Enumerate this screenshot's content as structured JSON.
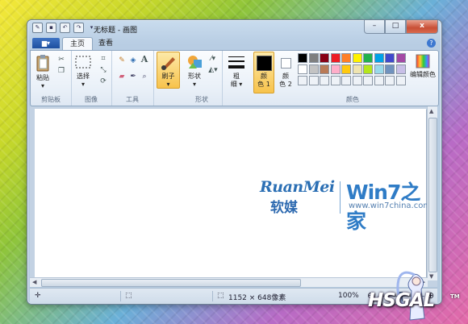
{
  "window": {
    "title": "无标题 - 画图",
    "controls": {
      "minimize": "–",
      "maximize": "□",
      "close": "x"
    }
  },
  "tabs": {
    "file_menu": "▆▾",
    "home": "主页",
    "view": "查看",
    "help": "?"
  },
  "ribbon": {
    "clipboard": {
      "paste": "粘贴",
      "group": "剪贴板"
    },
    "image": {
      "select": "选择",
      "group": "图像"
    },
    "tools": {
      "group": "工具",
      "text_glyph": "A"
    },
    "brush": {
      "label": "刷子"
    },
    "shapes": {
      "label": "形状",
      "group": "形状"
    },
    "size": {
      "line1": "粗",
      "line2": "细"
    },
    "color1": {
      "line1": "颜",
      "line2": "色 1"
    },
    "color2": {
      "line1": "颜",
      "line2": "色 2"
    },
    "colors": {
      "group": "颜色",
      "edit": "编辑颜色"
    }
  },
  "palette": {
    "row1": [
      "#000000",
      "#7f7f7f",
      "#880015",
      "#ed1c24",
      "#ff7f27",
      "#fff200",
      "#22b14c",
      "#00a2e8",
      "#3f48cc",
      "#a349a4"
    ],
    "row2": [
      "#ffffff",
      "#c3c3c3",
      "#b97a57",
      "#ffaec9",
      "#ffc90e",
      "#efe4b0",
      "#b5e61d",
      "#99d9ea",
      "#7092be",
      "#c8bfe7"
    ],
    "row3": [
      "#eef2f7",
      "#eef2f7",
      "#eef2f7",
      "#eef2f7",
      "#eef2f7",
      "#eef2f7",
      "#eef2f7",
      "#eef2f7",
      "#eef2f7",
      "#eef2f7"
    ],
    "color1": "#000000",
    "color2": "#ffffff"
  },
  "canvas_logo": {
    "ruanmei": "RuanMei",
    "ruanmei_cn": "软媒",
    "win7": "Win7之家",
    "url": "www.win7china.com"
  },
  "status": {
    "dimensions": "1152 × 648像素",
    "zoom": "100%",
    "zoom_out": "⊖",
    "zoom_in": "⊕"
  },
  "watermark": {
    "text": "HSGAL",
    "tm": "TM"
  }
}
